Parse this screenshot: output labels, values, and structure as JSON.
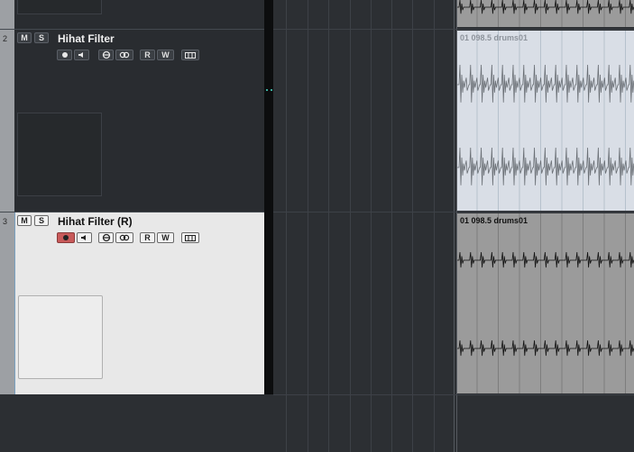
{
  "tracks": [
    {
      "number": "2",
      "name": "Hihat Filter",
      "mute_label": "M",
      "solo_label": "S",
      "read_label": "R",
      "write_label": "W",
      "record_enabled": false,
      "selected": false
    },
    {
      "number": "3",
      "name": "Hihat Filter (R)",
      "mute_label": "M",
      "solo_label": "S",
      "read_label": "R",
      "write_label": "W",
      "record_enabled": true,
      "selected": true
    }
  ],
  "clips": [
    {
      "label": "01 098.5 drums01",
      "selected": true
    },
    {
      "label": "01 098.5 drums01",
      "selected": false
    }
  ],
  "colors": {
    "record_active": "#c85a5a",
    "selected_track_bg": "#e8e8e8",
    "clip_selected_bg": "#d9dee6",
    "clip_bg": "#9b9b9b"
  }
}
